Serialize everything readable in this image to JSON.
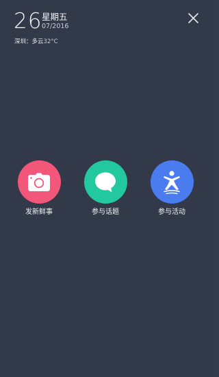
{
  "header": {
    "day": "26",
    "weekday": "星期五",
    "month_year": "07/2016",
    "weather_location": "深圳：多云",
    "weather_temp": "32°C"
  },
  "close_icon": "close-icon",
  "actions": [
    {
      "label": "发新鲜事",
      "icon": "camera-icon",
      "color": "#f2577a"
    },
    {
      "label": "参与话题",
      "icon": "speech-bubble-icon",
      "color": "#22c99e"
    },
    {
      "label": "参与活动",
      "icon": "person-activity-icon",
      "color": "#4a7cf0"
    }
  ]
}
